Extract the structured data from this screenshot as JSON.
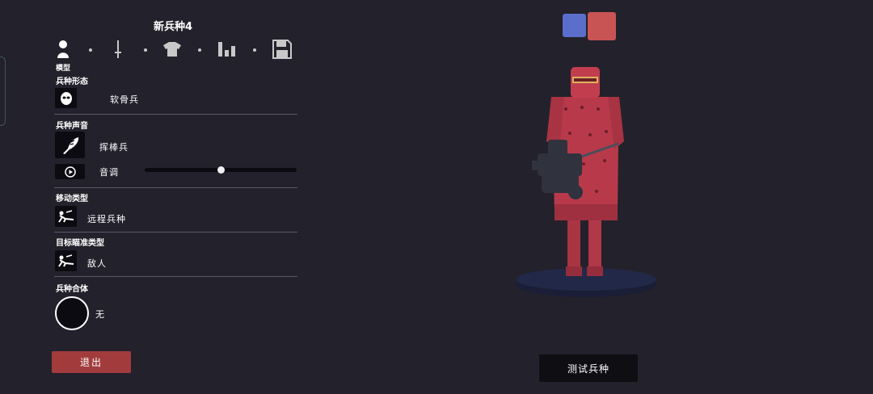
{
  "title": "新兵种4",
  "toolbar": {
    "active_label": "模型",
    "icons": [
      "person-icon",
      "sword-icon",
      "shirt-icon",
      "stats-icon",
      "save-icon"
    ]
  },
  "colors": {
    "team_blue": "#5b6ecb",
    "team_red": "#c95454",
    "exit_button": "#a23c3c",
    "unit_red": "#b8394a"
  },
  "sections": {
    "unit_form": {
      "label": "兵种形态",
      "value": "软骨兵"
    },
    "unit_voice": {
      "label": "兵种声音",
      "value": "挥棒兵",
      "pitch_label": "音调",
      "pitch_level": 0.5
    },
    "movement_type": {
      "label": "移动类型",
      "value": "远程兵种"
    },
    "target_type": {
      "label": "目标瞄准类型",
      "value": "敌人"
    },
    "unit_merge": {
      "label": "兵种合体",
      "value": "无"
    }
  },
  "buttons": {
    "exit": "退出",
    "test_unit": "测试兵种"
  }
}
